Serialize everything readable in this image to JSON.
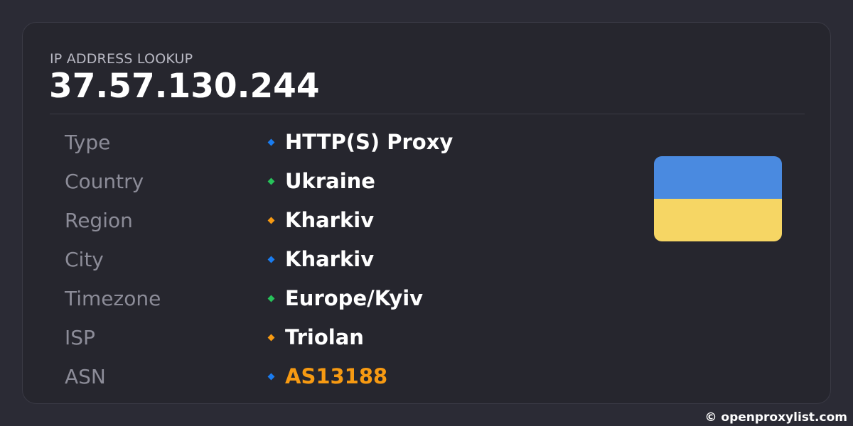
{
  "header": {
    "label": "IP ADDRESS LOOKUP",
    "ip": "37.57.130.244"
  },
  "rows": [
    {
      "label": "Type",
      "value": "HTTP(S) Proxy",
      "bullet_color": "#1a7cf0"
    },
    {
      "label": "Country",
      "value": "Ukraine",
      "bullet_color": "#27c25a"
    },
    {
      "label": "Region",
      "value": "Kharkiv",
      "bullet_color": "#f79a12"
    },
    {
      "label": "City",
      "value": "Kharkiv",
      "bullet_color": "#1a7cf0"
    },
    {
      "label": "Timezone",
      "value": "Europe/Kyiv",
      "bullet_color": "#27c25a"
    },
    {
      "label": "ISP",
      "value": "Triolan",
      "bullet_color": "#f79a12"
    },
    {
      "label": "ASN",
      "value": "AS13188",
      "bullet_color": "#1a7cf0"
    }
  ],
  "flag": {
    "icon": "ukraine-flag-icon",
    "top_color": "#4a8ae0",
    "bottom_color": "#f6d664"
  },
  "footer": {
    "text": "© openproxylist.com"
  },
  "colors": {
    "background": "#2b2b35",
    "card": "#26262e",
    "accent_link": "#f79a12"
  }
}
